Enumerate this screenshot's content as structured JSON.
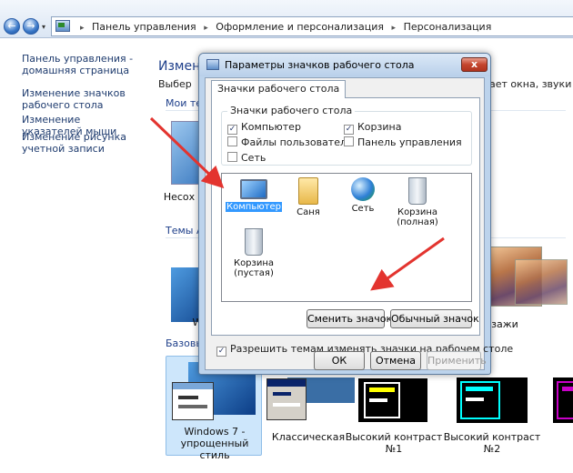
{
  "breadcrumb": [
    "Панель управления",
    "Оформление и персонализация",
    "Персонализация"
  ],
  "nav_buttons": {
    "back": "←",
    "forward": "→",
    "dropdown": "▾"
  },
  "leftnav": {
    "home": "Панель управления - домашняя страница",
    "links": [
      "Изменение значков рабочего стола",
      "Изменение указателей мыши",
      "Изменение рисунка учетной записи"
    ]
  },
  "main": {
    "title_fragment": "Измене",
    "subtitle_fragment": "Выбер",
    "subtitle_right_fragment": "ает окна, звуки и ст",
    "my_themes_fragment": "Мои тем",
    "unsaved_fragment": "Несох",
    "aero_fragment": "Темы Ae",
    "w_fragment": "W",
    "landscapes_fragment": "ейзажи",
    "basic_fragment": "Базовые",
    "basic_themes": [
      "Windows 7 - упрощенный стиль",
      "Классическая",
      "Высокий контраст №1",
      "Высокий контраст №2"
    ]
  },
  "dialog": {
    "title": "Параметры значков рабочего стола",
    "close": "x",
    "tab": "Значки рабочего стола",
    "group_title": "Значки рабочего стола",
    "checkboxes": [
      {
        "label": "Компьютер",
        "checked": true
      },
      {
        "label": "Корзина",
        "checked": true
      },
      {
        "label": "Файлы пользователя",
        "checked": false
      },
      {
        "label": "Панель управления",
        "checked": false
      },
      {
        "label": "Сеть",
        "checked": false
      }
    ],
    "check_mark": "✓",
    "icons": [
      {
        "label": "Компьютер",
        "icon": "computer-icon",
        "selected": true
      },
      {
        "label": "Саня",
        "icon": "user-folder-icon",
        "selected": false
      },
      {
        "label": "Сеть",
        "icon": "network-icon",
        "selected": false
      },
      {
        "label": "Корзина (полная)",
        "icon": "recycle-bin-full-icon",
        "selected": false
      },
      {
        "label": "Корзина (пустая)",
        "icon": "recycle-bin-empty-icon",
        "selected": false
      }
    ],
    "change_icon_btn": "Сменить значок...",
    "default_icon_btn": "Обычный значок",
    "allow_themes_label": "Разрешить темам изменять значки на рабочем столе",
    "allow_themes_checked": true,
    "ok": "ОК",
    "cancel": "Отмена",
    "apply": "Применить"
  },
  "colors": {
    "arrow": "#e3342f",
    "link": "#1e3b6e",
    "selection": "#3399ff",
    "high_contrast_1": "#ffff00",
    "high_contrast_2": "#00ffff",
    "high_contrast_3": "#c800c8"
  }
}
